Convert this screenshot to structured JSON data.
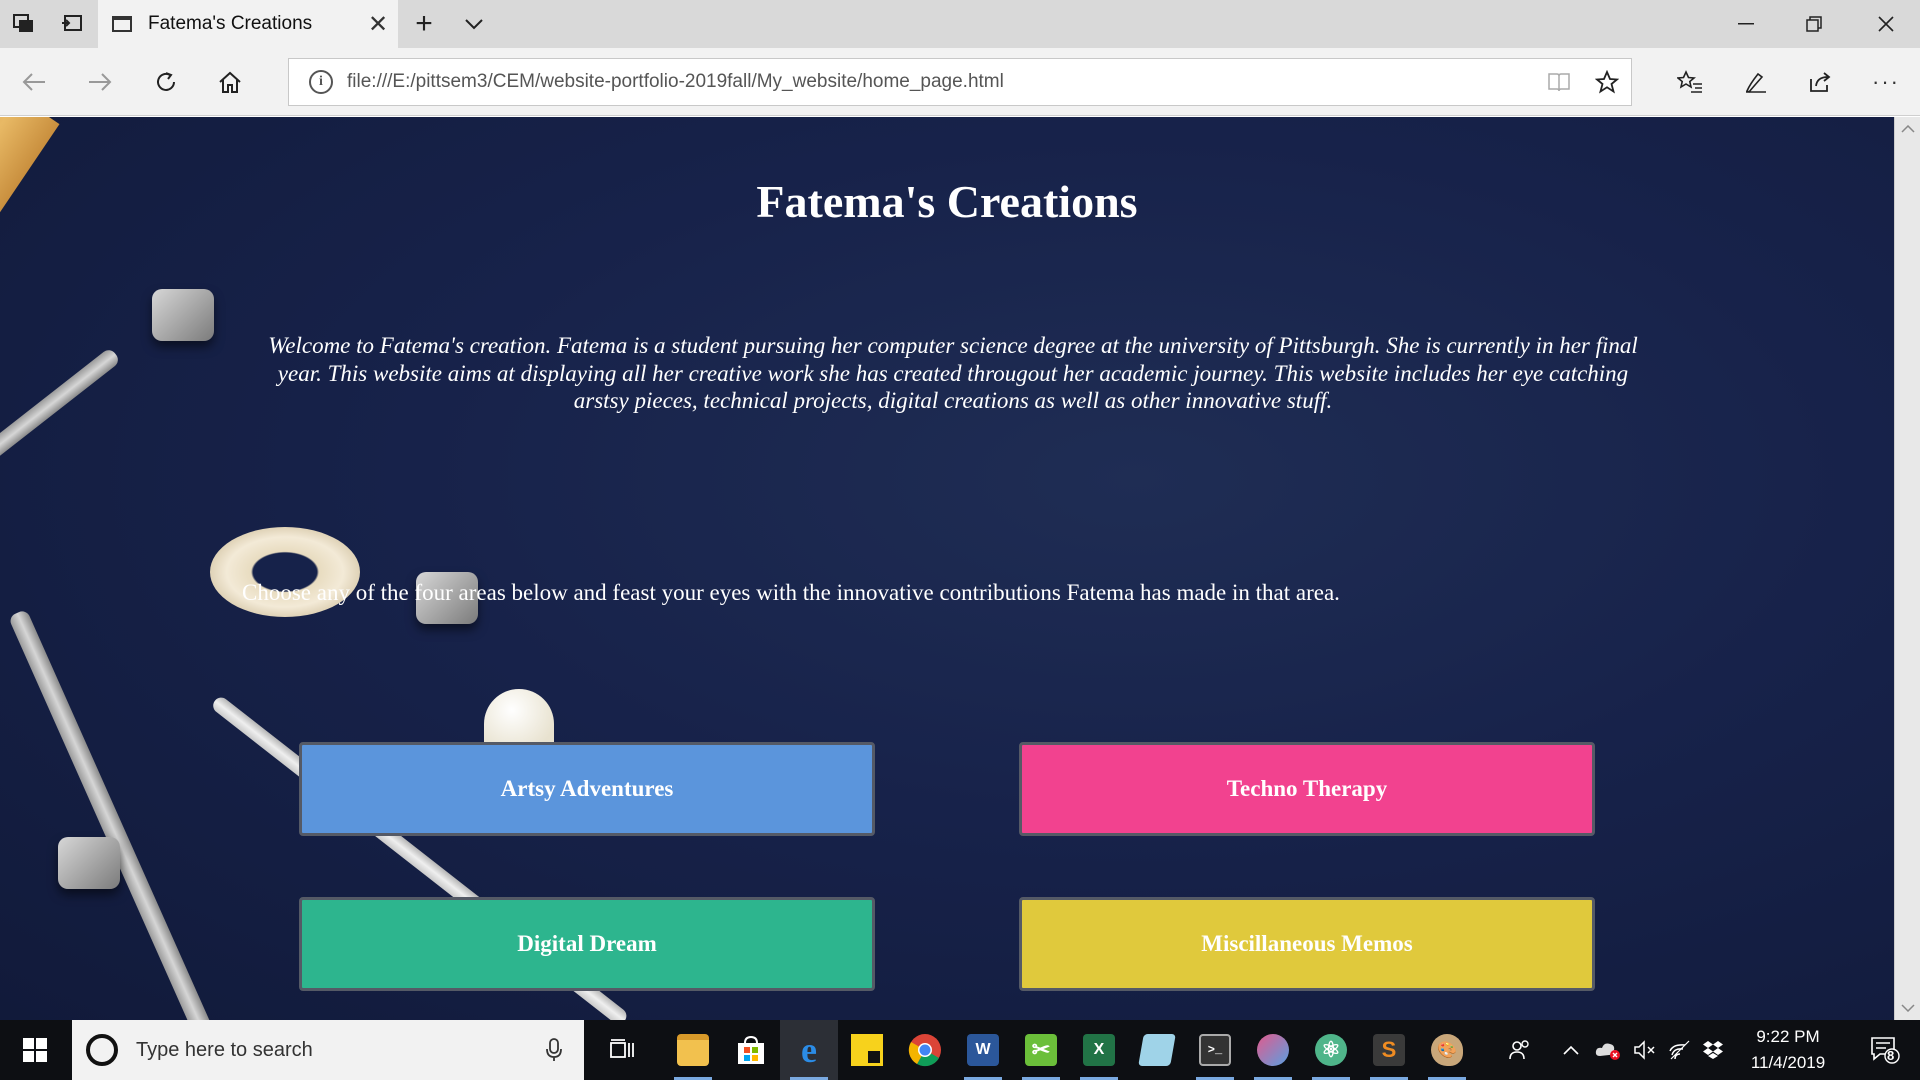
{
  "browser": {
    "tab": {
      "title": "Fatema's Creations",
      "close_glyph": "✕"
    },
    "new_tab_glyph": "+",
    "tab_list_glyph": "⌄",
    "window_controls": {
      "minimize": "—",
      "restore": "❐",
      "close": "✕"
    },
    "url": "file:///E:/pittsem3/CEM/website-portfolio-2019fall/My_website/home_page.html",
    "icons": [
      "set-aside-tabs-icon",
      "tab-preview-icon",
      "back-icon",
      "forward-icon",
      "refresh-icon",
      "home-icon",
      "info-icon",
      "reading-view-icon",
      "favorite-star-icon",
      "favorites-hub-icon",
      "pen-icon",
      "share-icon",
      "more-icon"
    ]
  },
  "page": {
    "title": "Fatema's Creations",
    "intro": "Welcome to Fatema's creation. Fatema is a student pursuing her computer science degree at the university of Pittsburgh. She is currently in her final year. This website aims at displaying all her creative work she has created througout her academic journey. This website includes her eye catching arstsy pieces, technical projects, digital creations as well as other innovative stuff.",
    "choose_text": "Choose any of the four areas below and feast your eyes with the innovative contributions Fatema has made in that area.",
    "areas": [
      {
        "label": "Artsy Adventures",
        "color": "#5b95dc"
      },
      {
        "label": "Techno Therapy",
        "color": "#f2428f"
      },
      {
        "label": "Digital Dream",
        "color": "#2db58e"
      },
      {
        "label": "Miscillaneous Memos",
        "color": "#e0c93c"
      }
    ]
  },
  "taskbar": {
    "search_placeholder": "Type here to search",
    "time": "9:22 PM",
    "date": "11/4/2019",
    "notification_count": "8",
    "apps": [
      {
        "name": "task-view-icon",
        "letter": ""
      },
      {
        "name": "file-explorer-icon",
        "letter": "",
        "color": "#f2c14e"
      },
      {
        "name": "store-icon",
        "letter": "",
        "color": "#ffffff"
      },
      {
        "name": "edge-icon",
        "letter": "e",
        "color": "#1e7fd6"
      },
      {
        "name": "sticky-notes-icon",
        "letter": "",
        "color": "#f7d21c"
      },
      {
        "name": "chrome-icon",
        "letter": "",
        "color": "#db4437"
      },
      {
        "name": "word-icon",
        "letter": "W",
        "color": "#2b579a"
      },
      {
        "name": "snipping-tool-icon",
        "letter": "",
        "color": "#6bbf3a"
      },
      {
        "name": "excel-icon",
        "letter": "X",
        "color": "#217346"
      },
      {
        "name": "notepad-icon",
        "letter": "",
        "color": "#9fd3e8"
      },
      {
        "name": "terminal-icon",
        "letter": ">_",
        "color": "#333333"
      },
      {
        "name": "paint-3d-icon",
        "letter": "",
        "color": "#e25a8c"
      },
      {
        "name": "atom-icon",
        "letter": "",
        "color": "#4fb58a"
      },
      {
        "name": "sublime-icon",
        "letter": "S",
        "color": "#f08c22"
      },
      {
        "name": "paint-icon",
        "letter": "",
        "color": "#c9a77a"
      }
    ]
  }
}
